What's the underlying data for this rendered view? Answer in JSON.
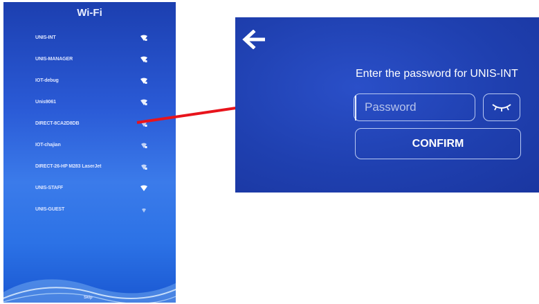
{
  "wifi": {
    "title": "Wi-Fi",
    "networks": [
      {
        "name": "UNIS-INT",
        "icon": "wifi-lock-icon"
      },
      {
        "name": "UNIS-MANAGER",
        "icon": "wifi-lock-icon"
      },
      {
        "name": "IOT-debug",
        "icon": "wifi-lock-icon"
      },
      {
        "name": "Unis9061",
        "icon": "wifi-lock-icon"
      },
      {
        "name": "DIRECT-8CA2D8DB",
        "icon": "wifi-lock-icon"
      },
      {
        "name": "IOT-chajian",
        "icon": "wifi-lock-icon"
      },
      {
        "name": "DIRECT-26-HP M283 LaserJet",
        "icon": "wifi-lock-icon"
      },
      {
        "name": "UNIS-STAFF",
        "icon": "wifi-icon"
      },
      {
        "name": "UNIS-GUEST",
        "icon": "wifi-weak-icon"
      }
    ],
    "bottom_label": "Skip"
  },
  "password_dialog": {
    "back_icon": "arrow-left-icon",
    "prompt": "Enter the password for UNIS-INT",
    "input_placeholder": "Password",
    "input_value": "",
    "toggle_icon": "eye-closed-icon",
    "confirm_label": "CONFIRM"
  },
  "colors": {
    "arrow": "#e8141c",
    "screen_bg": "#1f40b0",
    "border": "#b9c9f2"
  }
}
